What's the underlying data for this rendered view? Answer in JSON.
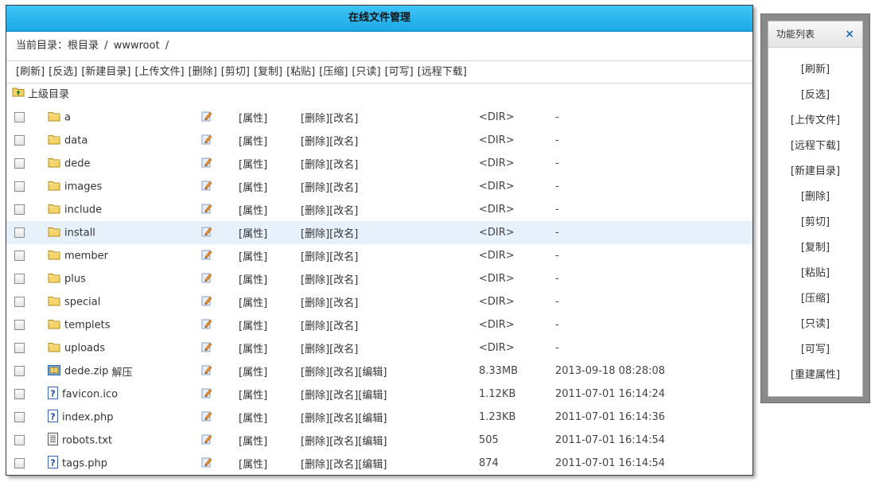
{
  "title": "在线文件管理",
  "path": {
    "label": "当前目录：",
    "root": "根目录",
    "sep1": "/",
    "dir": "wwwroot",
    "sep2": "/"
  },
  "toolbar": [
    "[刷新]",
    "[反选]",
    "[新建目录]",
    "[上传文件]",
    "[删除]",
    "[剪切]",
    "[复制]",
    "[粘贴]",
    "[压缩]",
    "[只读]",
    "[可写]",
    "[远程下载]"
  ],
  "up_label": "上级目录",
  "labels": {
    "attr": "[属性]",
    "delete": "[删除]",
    "rename": "[改名]",
    "edit": "[编辑]",
    "unzip": "解压"
  },
  "files": [
    {
      "name": "a",
      "type": "dir",
      "size": "<DIR>",
      "date": "-"
    },
    {
      "name": "data",
      "type": "dir",
      "size": "<DIR>",
      "date": "-"
    },
    {
      "name": "dede",
      "type": "dir",
      "size": "<DIR>",
      "date": "-"
    },
    {
      "name": "images",
      "type": "dir",
      "size": "<DIR>",
      "date": "-"
    },
    {
      "name": "include",
      "type": "dir",
      "size": "<DIR>",
      "date": "-"
    },
    {
      "name": "install",
      "type": "dir",
      "size": "<DIR>",
      "date": "-",
      "highlight": true
    },
    {
      "name": "member",
      "type": "dir",
      "size": "<DIR>",
      "date": "-"
    },
    {
      "name": "plus",
      "type": "dir",
      "size": "<DIR>",
      "date": "-"
    },
    {
      "name": "special",
      "type": "dir",
      "size": "<DIR>",
      "date": "-"
    },
    {
      "name": "templets",
      "type": "dir",
      "size": "<DIR>",
      "date": "-"
    },
    {
      "name": "uploads",
      "type": "dir",
      "size": "<DIR>",
      "date": "-"
    },
    {
      "name": "dede.zip",
      "type": "zip",
      "size": "8.33MB",
      "date": "2013-09-18 08:28:08"
    },
    {
      "name": "favicon.ico",
      "type": "unknown",
      "size": "1.12KB",
      "date": "2011-07-01 16:14:24"
    },
    {
      "name": "index.php",
      "type": "unknown",
      "size": "1.23KB",
      "date": "2011-07-01 16:14:36"
    },
    {
      "name": "robots.txt",
      "type": "text",
      "size": "505",
      "date": "2011-07-01 16:14:54"
    },
    {
      "name": "tags.php",
      "type": "unknown",
      "size": "874",
      "date": "2011-07-01 16:14:54"
    }
  ],
  "side": {
    "title": "功能列表",
    "close": "×",
    "items": [
      "[刷新]",
      "[反选]",
      "[上传文件]",
      "[远程下载]",
      "[新建目录]",
      "[删除]",
      "[剪切]",
      "[复制]",
      "[粘贴]",
      "[压缩]",
      "[只读]",
      "[可写]",
      "[重建属性]"
    ]
  },
  "colors": {
    "title_bar": "#29b6ee",
    "highlight_row": "#e6f1fb",
    "folder": "#f5d46b"
  }
}
